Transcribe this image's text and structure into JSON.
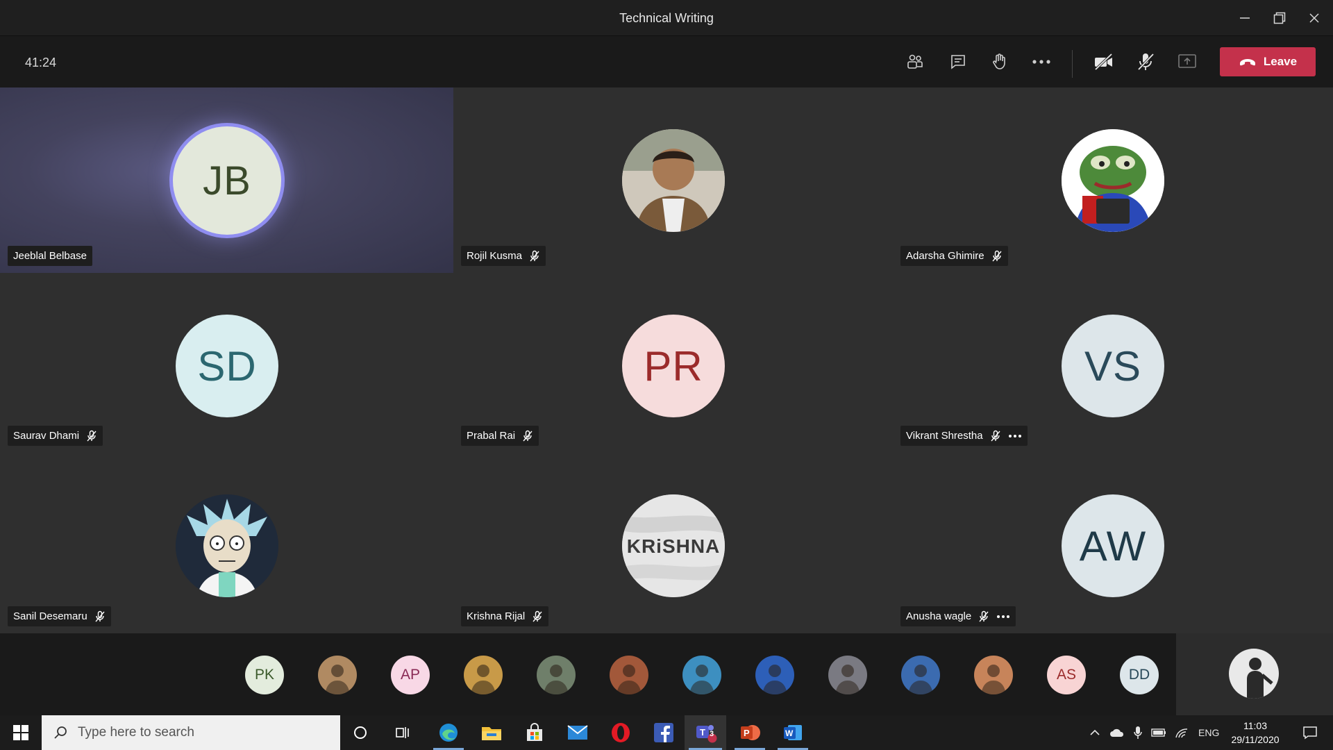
{
  "window": {
    "title": "Technical Writing"
  },
  "meeting": {
    "timer": "41:24",
    "leave_label": "Leave"
  },
  "participants": [
    {
      "name": "Jeeblal Belbase",
      "initials": "JB",
      "bg": "#e3e8db",
      "fg": "#3b4a2b",
      "active": true,
      "muted": false,
      "more": false,
      "photo": null
    },
    {
      "name": "Rojil Kusma",
      "initials": "",
      "bg": "#d9d2c6",
      "fg": "#333",
      "active": false,
      "muted": true,
      "more": false,
      "photo": "person"
    },
    {
      "name": "Adarsha Ghimire",
      "initials": "",
      "bg": "#ffffff",
      "fg": "#333",
      "active": false,
      "muted": true,
      "more": false,
      "photo": "frog"
    },
    {
      "name": "Saurav Dhami",
      "initials": "SD",
      "bg": "#d9eef0",
      "fg": "#2b6770",
      "active": false,
      "muted": true,
      "more": false,
      "photo": null
    },
    {
      "name": "Prabal Rai",
      "initials": "PR",
      "bg": "#f6dcdc",
      "fg": "#9b2b2b",
      "active": false,
      "muted": true,
      "more": false,
      "photo": null
    },
    {
      "name": "Vikrant Shrestha",
      "initials": "VS",
      "bg": "#dde6ea",
      "fg": "#2a4a5a",
      "active": false,
      "muted": true,
      "more": true,
      "photo": null
    },
    {
      "name": "Sanil Desemaru",
      "initials": "",
      "bg": "#1f2a3a",
      "fg": "#fff",
      "active": false,
      "muted": true,
      "more": false,
      "photo": "cartoon"
    },
    {
      "name": "Krishna Rijal",
      "initials": "",
      "bg": "#e8e8e8",
      "fg": "#333",
      "active": false,
      "muted": true,
      "more": false,
      "photo": "text",
      "photo_text": "KRiSHNA"
    },
    {
      "name": "Anusha wagle",
      "initials": "AW",
      "bg": "#dde6ea",
      "fg": "#1f3a48",
      "active": false,
      "muted": true,
      "more": true,
      "photo": null
    }
  ],
  "roster": [
    {
      "initials": "PK",
      "bg": "#e3ecdd",
      "fg": "#3b5a2b"
    },
    {
      "initials": "",
      "bg": "#b08a62",
      "fg": "#fff"
    },
    {
      "initials": "AP",
      "bg": "#f8d8e6",
      "fg": "#8a2a55"
    },
    {
      "initials": "",
      "bg": "#c89a48",
      "fg": "#fff"
    },
    {
      "initials": "",
      "bg": "#6f7f6a",
      "fg": "#fff"
    },
    {
      "initials": "",
      "bg": "#a2583a",
      "fg": "#fff"
    },
    {
      "initials": "",
      "bg": "#3d8fc0",
      "fg": "#fff"
    },
    {
      "initials": "",
      "bg": "#2d5fb8",
      "fg": "#fff"
    },
    {
      "initials": "",
      "bg": "#7a7a82",
      "fg": "#fff"
    },
    {
      "initials": "",
      "bg": "#3b6bb0",
      "fg": "#fff"
    },
    {
      "initials": "",
      "bg": "#c7845a",
      "fg": "#fff"
    },
    {
      "initials": "AS",
      "bg": "#f8d4d4",
      "fg": "#9b2b2b"
    },
    {
      "initials": "DD",
      "bg": "#dde6ea",
      "fg": "#2a4a5a"
    }
  ],
  "taskbar": {
    "search_placeholder": "Type here to search",
    "teams_badge": "3",
    "language": "ENG",
    "time": "11:03",
    "date": "29/11/2020"
  },
  "colors": {
    "leave": "#c4314b",
    "active_ring": "#8f8df0"
  }
}
